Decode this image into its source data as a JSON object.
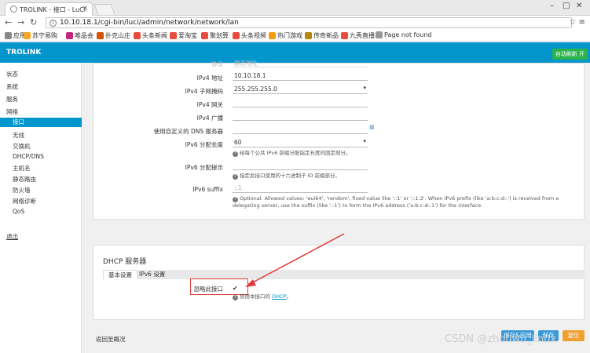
{
  "browser": {
    "tab_title": "TROLINK - 接口 - LuCI",
    "url": "10.10.18.1/cgi-bin/luci/admin/network/network/lan",
    "bookmarks": [
      "应用",
      "苏宁易购",
      "唯品会",
      "扑克山庄",
      "头条新闻",
      "爱淘宝",
      "聚划算",
      "头条视频",
      "热门游戏",
      "传奇新品",
      "九秀直播",
      "Page not found"
    ]
  },
  "header": {
    "brand": "TROLINK",
    "refresh_label": "自动刷新 开"
  },
  "sidebar": {
    "items": [
      "状态",
      "系统",
      "服务",
      "网络"
    ],
    "network_sub": [
      "接口",
      "无线",
      "交换机",
      "DHCP/DNS",
      "主机名",
      "静态路由",
      "防火墙",
      "网络诊断",
      "QoS"
    ],
    "logout": "退出"
  },
  "form": {
    "partial_label": "协议",
    "partial_value": "静态地址",
    "rows": [
      {
        "label": "IPv4 地址",
        "value": "10.10.18.1"
      },
      {
        "label": "IPv4 子网掩码",
        "value": "255.255.255.0"
      },
      {
        "label": "IPv4 网关",
        "value": ""
      },
      {
        "label": "IPv4 广播",
        "value": ""
      },
      {
        "label": "使用自定义的 DNS 服务器",
        "value": ""
      },
      {
        "label": "IPv6 分配长度",
        "value": "60"
      },
      {
        "label": "IPv6 分配提示",
        "value": ""
      },
      {
        "label": "IPv6 suffix",
        "value": "::1"
      }
    ],
    "hint_ipv6_len": "给每个公共 IPv6 前缀分配指定长度的固定部分。",
    "hint_ipv6_hint": "指定此接口使用的十六进制子 ID 前缀部分。",
    "hint_suffix_1": "Optional. Allowed values: 'eui64', 'random', fixed value like '::1' or '::1:2'. When IPv6 prefix (like 'a:b:c:d::') is received from a",
    "hint_suffix_2": "delegating server, use the suffix (like '::1') to form the IPv6 address ('a:b:c:d::1') for the interface."
  },
  "dhcp": {
    "title": "DHCP 服务器",
    "tabs": [
      "基本设置",
      "IPv6 设置"
    ],
    "ignore_label": "忽略此接口",
    "ignore_checked": "✔",
    "hint_prefix": "禁用本接口的",
    "hint_link": "DHCP",
    "hint_suffix": "。"
  },
  "footer": {
    "back_label": "返回至概况",
    "buttons": [
      "保存&应用",
      "保存",
      "复位"
    ],
    "watermark": "CSDN @zhouwu_linux"
  },
  "colors": {
    "brand_blue": "#0396cd",
    "refresh_green": "#2bb34b",
    "callout_red": "#e03a3a"
  }
}
